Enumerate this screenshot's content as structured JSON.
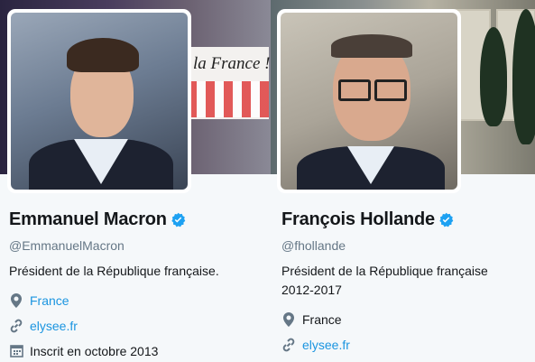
{
  "profiles": [
    {
      "name": "Emmanuel Macron",
      "handle": "@EmmanuelMacron",
      "bio": [
        "Président de la République française."
      ],
      "location": "France",
      "website": "elysee.fr",
      "joined": "Inscrit en octobre 2013",
      "banner_text": "la France !",
      "verified_icon": "verified-badge-icon"
    },
    {
      "name": "François Hollande",
      "handle": "@fhollande",
      "bio": [
        "Président de la République française",
        "2012-2017"
      ],
      "location": "France",
      "website": "elysee.fr",
      "verified_icon": "verified-badge-icon"
    }
  ],
  "colors": {
    "link": "#1b95e0",
    "verified": "#1da1f2",
    "secondary_text": "#657786"
  }
}
